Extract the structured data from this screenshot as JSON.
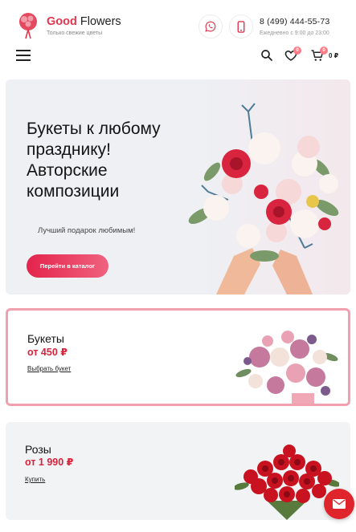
{
  "header": {
    "brand_first": "Good",
    "brand_second": "Flowers",
    "tagline": "Только свежие цветы",
    "phone": "8 (499) 444-55-73",
    "hours": "Ежедневно с 9:00 до 23:00",
    "wishlist_count": "0",
    "cart_count": "0",
    "cart_total": "0 ₽",
    "icons": [
      "menu-icon",
      "whatsapp-icon",
      "mobile-phone-icon",
      "search-icon",
      "heart-icon",
      "cart-icon"
    ]
  },
  "hero": {
    "title": "Букеты к любому празднику! Авторские композиции",
    "subtitle": "Лучший подарок любимым!",
    "button": "Перейти в каталог"
  },
  "categories": [
    {
      "title": "Букеты",
      "price": "от 450 ₽",
      "link": "Выбрать букет"
    },
    {
      "title": "Розы",
      "price": "от 1 990 ₽",
      "link": "Купить"
    }
  ],
  "colors": {
    "accent": "#e0364e",
    "price": "#d9233c",
    "fab": "#e0242c",
    "active_border": "#f2a0ae"
  }
}
